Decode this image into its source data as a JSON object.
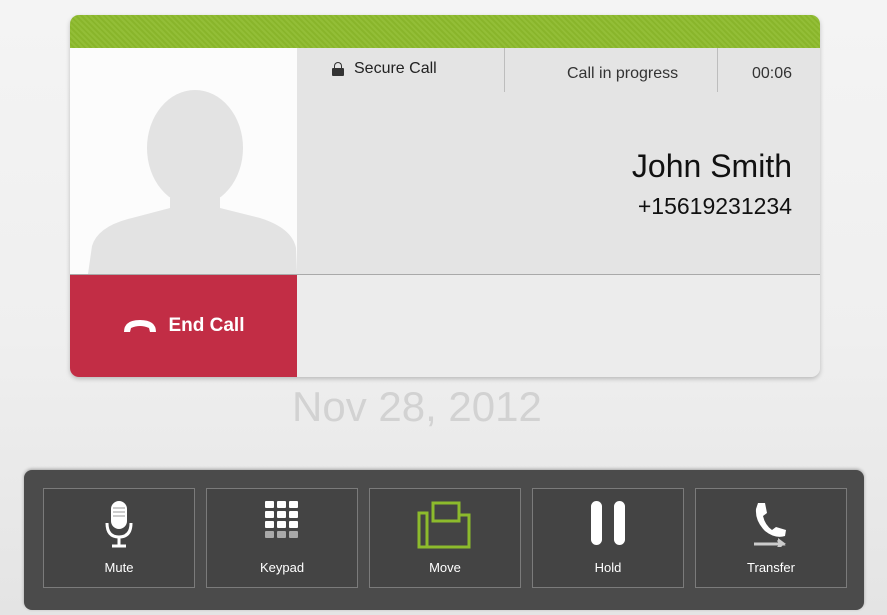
{
  "call": {
    "secure_label": "Secure Call",
    "status": "Call in progress",
    "timer": "00:06",
    "caller_name": "John Smith",
    "caller_number": "+15619231234",
    "end_call_label": "End Call",
    "date": "Nov 28, 2012"
  },
  "toolbar": {
    "buttons": [
      {
        "label": "Mute",
        "icon": "microphone-icon"
      },
      {
        "label": "Keypad",
        "icon": "keypad-icon"
      },
      {
        "label": "Move",
        "icon": "move-icon"
      },
      {
        "label": "Hold",
        "icon": "pause-icon"
      },
      {
        "label": "Transfer",
        "icon": "transfer-icon"
      }
    ]
  },
  "colors": {
    "top_bar": "#8dbb2c",
    "end_call": "#c22d45",
    "move_accent": "#8dbb2c",
    "toolbar_bg": "#4b4b4b"
  }
}
